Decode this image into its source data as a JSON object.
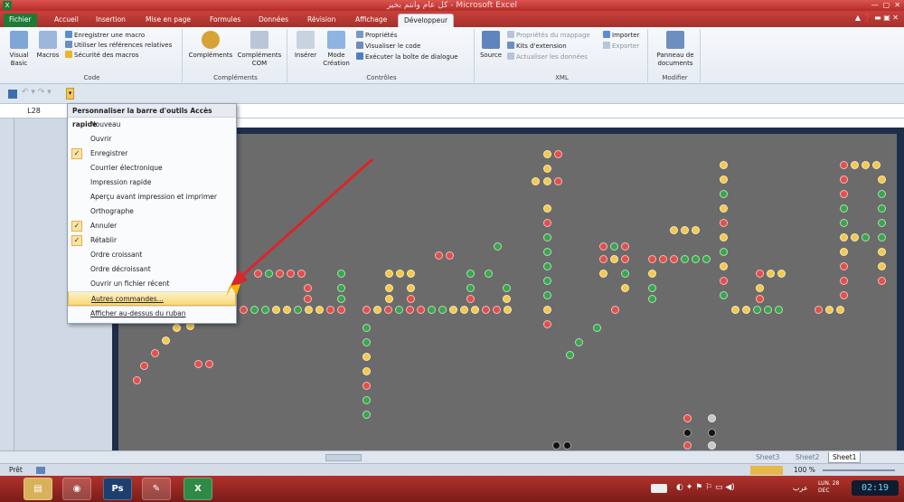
{
  "window": {
    "title": "كل عام وانتم بخير - Microsoft Excel"
  },
  "tabs": [
    "Fichier",
    "Accueil",
    "Insertion",
    "Mise en page",
    "Formules",
    "Données",
    "Révision",
    "Affichage",
    "Développeur"
  ],
  "ribbon": {
    "code": {
      "label": "Code",
      "visual_basic": "Visual Basic",
      "macros": "Macros",
      "record_macro": "Enregistrer une macro",
      "relative_refs": "Utiliser les références relatives",
      "macro_security": "Sécurité des macros"
    },
    "complements": {
      "label": "Compléments",
      "complements": "Compléments",
      "com": "Compléments COM"
    },
    "controls": {
      "label": "Contrôles",
      "insert": "Insérer",
      "design_mode": "Mode Création",
      "properties": "Propriétés",
      "view_code": "Visualiser le code",
      "run_dialog": "Exécuter la boîte de dialogue"
    },
    "xml": {
      "label": "XML",
      "source": "Source",
      "map_props": "Propriétés du mappage",
      "ext_packs": "Kits d'extension",
      "refresh": "Actualiser les données",
      "import": "Importer",
      "export": "Exporter"
    },
    "modify": {
      "label": "Modifier",
      "doc_panel": "Panneau de documents"
    }
  },
  "namebox": "L28",
  "qat_menu": {
    "title": "Personnaliser la barre d'outils Accès rapide",
    "items": [
      {
        "label": "Nouveau",
        "checked": false
      },
      {
        "label": "Ouvrir",
        "checked": false
      },
      {
        "label": "Enregistrer",
        "checked": true
      },
      {
        "label": "Courrier électronique",
        "checked": false
      },
      {
        "label": "Impression rapide",
        "checked": false
      },
      {
        "label": "Aperçu avant impression et imprimer",
        "checked": false
      },
      {
        "label": "Orthographe",
        "checked": false
      },
      {
        "label": "Annuler",
        "checked": true
      },
      {
        "label": "Rétablir",
        "checked": true
      },
      {
        "label": "Ordre croissant",
        "checked": false
      },
      {
        "label": "Ordre décroissant",
        "checked": false
      },
      {
        "label": "Ouvrir un fichier récent",
        "checked": false
      }
    ],
    "more": "Autres commandes...",
    "below": "Afficher au-dessus du ruban"
  },
  "sheets": [
    "Sheet3",
    "Sheet2",
    "Sheet1"
  ],
  "status": {
    "ready": "Prêt",
    "zoom": "100 %"
  },
  "taskbar": {
    "lang": "عرب",
    "date": "LUN. 28 DEC",
    "time": "02:19"
  },
  "colors": {
    "accent": "#c9413c",
    "file_tab": "#1f7a35"
  }
}
